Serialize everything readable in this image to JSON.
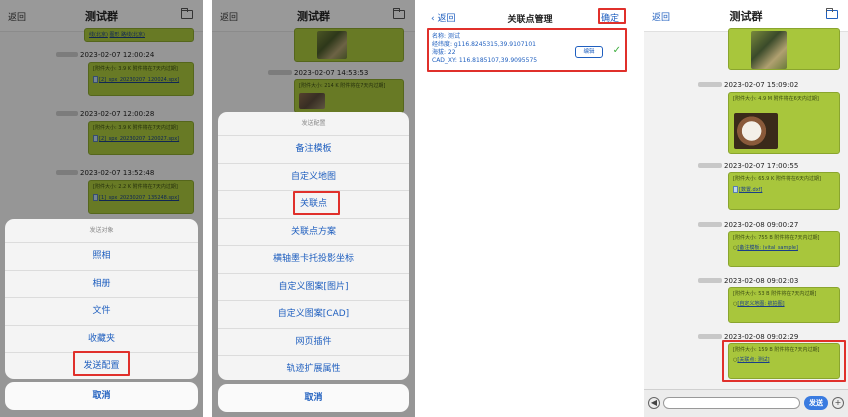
{
  "panel1": {
    "back": "返回",
    "title": "测试群",
    "top_bubble_text": "线(北京)",
    "top_bubble_text2": "图形 路线(北京)",
    "messages": [
      {
        "time": "2023-02-07 12:00:24",
        "info": "[附件大小: 3.9 K 附件将在7天内过期]",
        "file": "[2]_spx_20230207_120024.spx]"
      },
      {
        "time": "2023-02-07 12:00:28",
        "info": "[附件大小: 3.9 K 附件将在7天内过期]",
        "file": "[2]_spx_20230207_120027.spx]"
      },
      {
        "time": "2023-02-07 13:52:48",
        "info": "[附件大小: 2.2 K 附件将在7天内过期]",
        "file": "[1]_spx_20230207_135248.spx]"
      }
    ],
    "sheet_header": "发送对象",
    "options": [
      "照相",
      "相册",
      "文件",
      "收藏夹",
      "发送配置"
    ],
    "cancel": "取消"
  },
  "panel2": {
    "back": "返回",
    "title": "测试群",
    "time": "2023-02-07 14:53:53",
    "info": "[附件大小: 214 K 附件将在7天内过期]",
    "sheet_header": "发送配置",
    "options": [
      "备注模板",
      "自定义地图",
      "关联点",
      "关联点方案",
      "横轴墨卡托投影坐标",
      "自定义图案[图片]",
      "自定义图案[CAD]",
      "网页插件",
      "轨迹扩展属性"
    ],
    "cancel": "取消"
  },
  "panel3": {
    "back": "返回",
    "title": "关联点管理",
    "confirm": "确定",
    "name": "名称: 测试",
    "latlon": "经纬度: g116.8245315,39.9107101",
    "altitude": "海拔: 22",
    "cad": "CAD_XY: 116.8185107,39.9095575",
    "edit": "编辑",
    "check": "✓"
  },
  "panel4": {
    "back": "返回",
    "title": "测试群",
    "messages": [
      {
        "time": "2023-02-07 15:09:02",
        "info": "[附件大小: 4.9 M 附件将在6天内过期]",
        "file": ""
      },
      {
        "time": "2023-02-07 17:00:55",
        "info": "[附件大小: 65.9 K 附件将在6天内过期]",
        "file": "[数置.dxf]"
      },
      {
        "time": "2023-02-08 09:00:27",
        "info": "[附件大小: 755 B 附件将在7天内过期]",
        "file": "[备注模板: (vital_sample]"
      },
      {
        "time": "2023-02-08 09:02:03",
        "info": "[附件大小: 53 B 附件将在7天内过期]",
        "file": "[自定义地图: 航拍图]"
      },
      {
        "time": "2023-02-08 09:02:29",
        "info": "[附件大小: 159 B 附件将在7天内过期]",
        "file": "[关联点: 测试]"
      }
    ],
    "send": "发送",
    "left_icon": "◀",
    "plus_icon": "+"
  },
  "colors": {
    "accent": "#1f5fbf",
    "bubble": "#a8c63c",
    "highlight": "#e0302b"
  }
}
